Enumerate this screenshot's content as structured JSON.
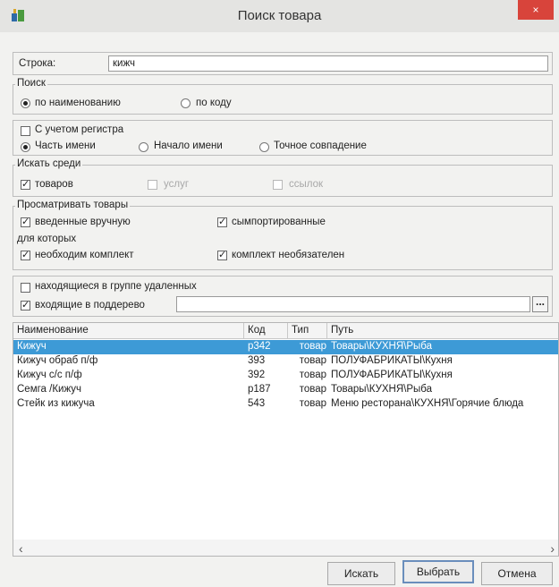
{
  "window": {
    "title": "Поиск товара",
    "close_glyph": "×"
  },
  "search": {
    "label": "Строка:",
    "value": "кижч"
  },
  "search_by": {
    "legend": "Поиск",
    "options": [
      {
        "label": "по наименованию",
        "checked": true
      },
      {
        "label": "по коду",
        "checked": false
      }
    ]
  },
  "case_sensitive": {
    "label": "С учетом регистра",
    "checked": false
  },
  "match_mode": {
    "options": [
      {
        "label": "Часть имени",
        "checked": true
      },
      {
        "label": "Начало имени",
        "checked": false
      },
      {
        "label": "Точное совпадение",
        "checked": false
      }
    ]
  },
  "search_among": {
    "legend": "Искать среди",
    "options": [
      {
        "label": "товаров",
        "checked": true,
        "enabled": true
      },
      {
        "label": "услуг",
        "checked": false,
        "enabled": false
      },
      {
        "label": "ссылок",
        "checked": false,
        "enabled": false
      }
    ]
  },
  "view_goods": {
    "legend": "Просматривать товары",
    "options": [
      {
        "label": "введенные вручную",
        "checked": true
      },
      {
        "label": "сымпортированные",
        "checked": true
      }
    ]
  },
  "for_which": {
    "legend": "для которых",
    "options": [
      {
        "label": "необходим комплект",
        "checked": true
      },
      {
        "label": "комплект необязателен",
        "checked": true
      }
    ]
  },
  "deleted_group": {
    "label": "находящиеся в группе удаленных",
    "checked": false
  },
  "subtree": {
    "label": "входящие в поддерево",
    "checked": true,
    "value": "",
    "browse": "..."
  },
  "table": {
    "columns": [
      "Наименование",
      "Код",
      "Тип",
      "Путь"
    ],
    "rows": [
      {
        "name": "Кижуч",
        "code": "р342",
        "type": "товар",
        "path": "Товары\\КУХНЯ\\Рыба",
        "selected": true
      },
      {
        "name": "Кижуч обраб п/ф",
        "code": "393",
        "type": "товар",
        "path": "ПОЛУФАБРИКАТЫ\\Кухня",
        "selected": false
      },
      {
        "name": "Кижуч с/с п/ф",
        "code": "392",
        "type": "товар",
        "path": "ПОЛУФАБРИКАТЫ\\Кухня",
        "selected": false
      },
      {
        "name": "Семга /Кижуч",
        "code": "р187",
        "type": "товар",
        "path": "Товары\\КУХНЯ\\Рыба",
        "selected": false
      },
      {
        "name": "Стейк из кижуча",
        "code": "543",
        "type": "товар",
        "path": "Меню ресторана\\КУХНЯ\\Горячие блюда",
        "selected": false
      }
    ]
  },
  "buttons": {
    "search": "Искать",
    "select": "Выбрать",
    "cancel": "Отмена"
  },
  "colors": {
    "selection": "#3d9ad6",
    "close": "#d8443b"
  },
  "icons": {
    "app": "app-icon",
    "scroll_left": "‹",
    "scroll_right": "›",
    "check": "✓"
  }
}
